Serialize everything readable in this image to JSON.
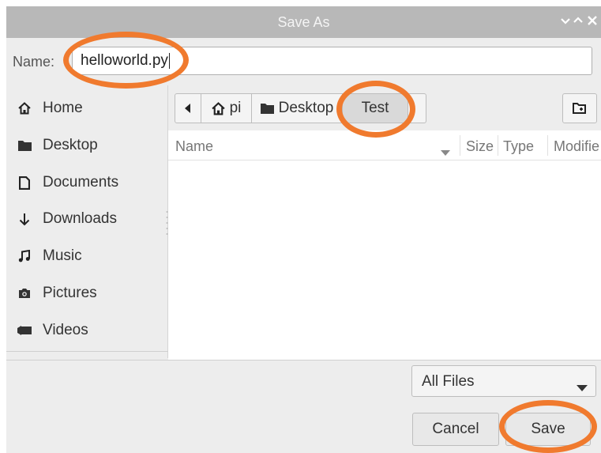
{
  "window": {
    "title": "Save As"
  },
  "name_row": {
    "label": "Name:",
    "value": "helloworld.py"
  },
  "sidebar": {
    "items": [
      {
        "label": "Home",
        "icon": "home-icon"
      },
      {
        "label": "Desktop",
        "icon": "folder-icon"
      },
      {
        "label": "Documents",
        "icon": "document-icon"
      },
      {
        "label": "Downloads",
        "icon": "download-icon"
      },
      {
        "label": "Music",
        "icon": "music-icon"
      },
      {
        "label": "Pictures",
        "icon": "camera-icon"
      },
      {
        "label": "Videos",
        "icon": "video-icon"
      }
    ]
  },
  "pathbar": {
    "crumbs": [
      {
        "label": "pi",
        "icon": "home-icon"
      },
      {
        "label": "Desktop",
        "icon": "folder-icon"
      },
      {
        "label": "Test",
        "active": true
      }
    ]
  },
  "columns": {
    "name": "Name",
    "size": "Size",
    "type": "Type",
    "modified": "Modifie"
  },
  "filter": {
    "selected": "All Files"
  },
  "buttons": {
    "cancel": "Cancel",
    "save": "Save"
  },
  "colors": {
    "annotation": "#f07a2e",
    "titlebar": "#b8b8b8",
    "dialog_bg": "#ededed"
  }
}
